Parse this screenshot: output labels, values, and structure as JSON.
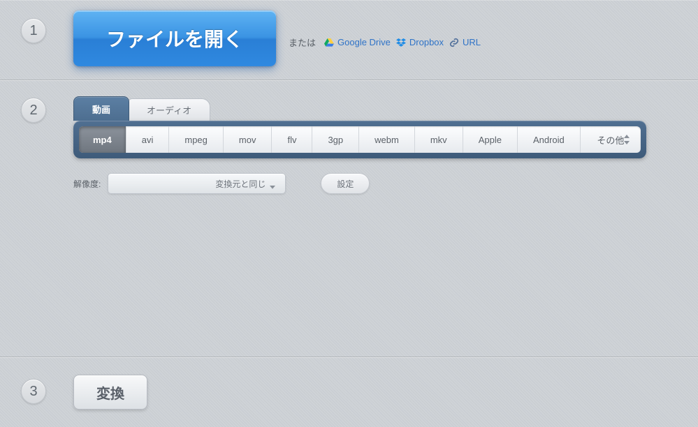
{
  "step1": {
    "number": "1",
    "open_button": "ファイルを開く",
    "or": "または",
    "google_drive": "Google Drive",
    "dropbox": "Dropbox",
    "url": "URL"
  },
  "step2": {
    "number": "2",
    "tabs": {
      "video": "動画",
      "audio": "オーディオ"
    },
    "formats": [
      "mp4",
      "avi",
      "mpeg",
      "mov",
      "flv",
      "3gp",
      "webm",
      "mkv",
      "Apple",
      "Android"
    ],
    "more": "その他",
    "active_format_index": 0,
    "resolution_label": "解像度:",
    "resolution_value": "変換元と同じ",
    "settings_button": "設定"
  },
  "step3": {
    "number": "3",
    "convert_button": "変換"
  }
}
